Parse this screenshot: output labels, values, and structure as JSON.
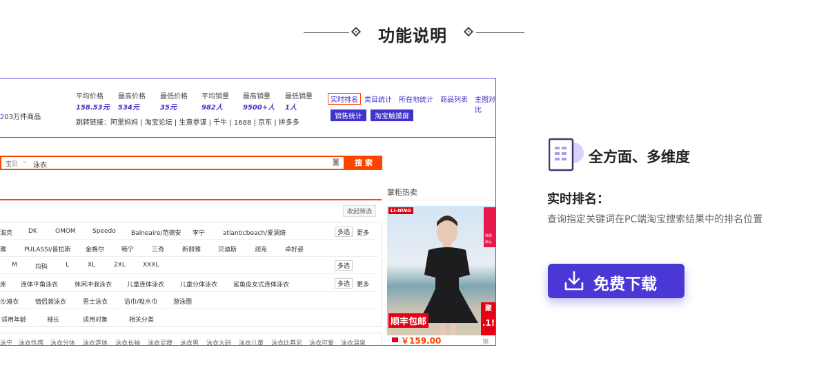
{
  "heading": {
    "title": "功能说明"
  },
  "screenshot": {
    "count_suffix": "03万件商品",
    "stats": [
      {
        "label": "平均价格",
        "value": "158.53元"
      },
      {
        "label": "最高价格",
        "value": "534元"
      },
      {
        "label": "最低价格",
        "value": "35元"
      },
      {
        "label": "平均销量",
        "value": "982人"
      },
      {
        "label": "最高销量",
        "value": "9500+人"
      },
      {
        "label": "最低销量",
        "value": "1人"
      }
    ],
    "jump_links": "跳转链接：阿里妈妈 | 淘宝论坛 | 生意参谋 | 千牛 | 1688 | 京东 | 拼多多",
    "top_links": [
      "实时排名",
      "类目统计",
      "所在地统计",
      "商品列表",
      "主图对比"
    ],
    "buttons": [
      "销售统计",
      "淘宝触摸屏"
    ],
    "search": {
      "scope": "宝贝",
      "query": "泳衣",
      "button": "搜 索"
    },
    "hot_title": "掌柜热卖",
    "collapse": "收起筛选",
    "brand_row1": [
      "泅克",
      "DK",
      "OMOM",
      "Speedo",
      "Balneaire/范德安",
      "李宁",
      "atlanticbeach/爱澜绮"
    ],
    "brand_row2": [
      "雅",
      "PULASSI/普拉斯",
      "金格尔",
      "畅宁",
      "三奇",
      "新丽雅",
      "贝迪斯",
      "润克",
      "卓好姿"
    ],
    "size_row": [
      "M",
      "均码",
      "L",
      "XL",
      "2XL",
      "XXXL"
    ],
    "type_row": [
      "库",
      "连体平角泳衣",
      "休闲冲浪泳衣",
      "儿童连体泳衣",
      "儿童分体泳衣",
      "鲨鱼皮女式连体泳衣"
    ],
    "type_row2": [
      "沙滩衣",
      "情侣装泳衣",
      "男士泳衣",
      "浴巾/吸水巾",
      "游泳圈"
    ],
    "filters": [
      "适用年龄",
      "袖长",
      "适用对象",
      "相关分类"
    ],
    "multi": "多选",
    "more": "更多",
    "related": [
      "泳宁",
      "泳衣性感",
      "泳衣分体",
      "泳衣连体",
      "泳衣长袖",
      "泳衣显瘦",
      "泳衣男",
      "泳衣大码",
      "泳衣儿童",
      "泳衣比基尼",
      "泳衣可爱",
      "泳衣温泉"
    ],
    "product": {
      "brand": "LI-NING",
      "promo": "顺丰包邮",
      "price": "￥159.00",
      "sales_label": "销量:",
      "side1": "换购",
      "side2": "默认",
      "side3": "聚",
      "side4": ".1!"
    }
  },
  "feature": {
    "title": "全方面、多维度",
    "sub_title": "实时排名：",
    "description": "查询指定关键词在PC端淘宝搜索结果中的排名位置",
    "download": "免费下载"
  },
  "colors": {
    "accent": "#4a38d6",
    "orange": "#ff4400",
    "red": "#e60012"
  }
}
